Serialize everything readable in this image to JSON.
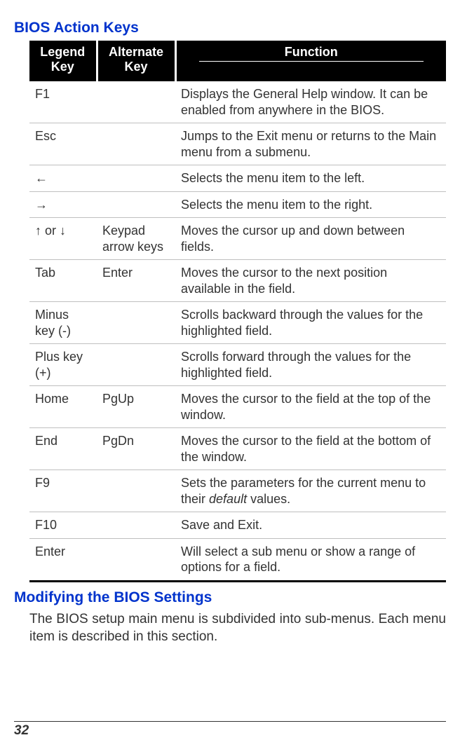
{
  "headings": {
    "section1": "BIOS Action Keys",
    "section2": "Modifying the BIOS Settings"
  },
  "table": {
    "headers": {
      "legend": "Legend Key",
      "alt": "Alternate Key",
      "func": "Function"
    },
    "rows": [
      {
        "legend": "F1",
        "alt": "",
        "func": "Displays the General Help window.  It can be enabled from anywhere in the BIOS."
      },
      {
        "legend": "Esc",
        "alt": "",
        "func": "Jumps to the Exit menu or returns to the Main menu from a submenu."
      },
      {
        "legend": "←",
        "alt": "",
        "func": "Selects the menu item to the left."
      },
      {
        "legend": "→",
        "alt": "",
        "func": "Selects the menu item to the right."
      },
      {
        "legend": "↑ or ↓",
        "alt": "Keypad arrow keys",
        "func": "Moves the cursor up and down between fields."
      },
      {
        "legend": "Tab",
        "alt": "Enter",
        "func": "Moves the cursor to the next position available in the field."
      },
      {
        "legend": "Minus key (-)",
        "alt": "",
        "func": "Scrolls backward through the values for the highlighted field."
      },
      {
        "legend": "Plus key (+)",
        "alt": "",
        "func": "Scrolls forward through the values for the highlighted field."
      },
      {
        "legend": "Home",
        "alt": "PgUp",
        "func": "Moves the cursor to the field at the top of the window."
      },
      {
        "legend": "End",
        "alt": "PgDn",
        "func": "Moves the cursor to the field at the bottom of the window."
      },
      {
        "legend": "F9",
        "alt": "",
        "func_pre": "Sets the parameters for the current menu to their ",
        "func_em": "default",
        "func_post": " values."
      },
      {
        "legend": "F10",
        "alt": "",
        "func": "Save and Exit."
      },
      {
        "legend": "Enter",
        "alt": "",
        "func": "Will select a sub menu or show a range of options for a field."
      }
    ]
  },
  "body": {
    "para1": "The BIOS setup main menu is subdivided into sub-menus.  Each menu item is described in this section."
  },
  "page_number": "32"
}
